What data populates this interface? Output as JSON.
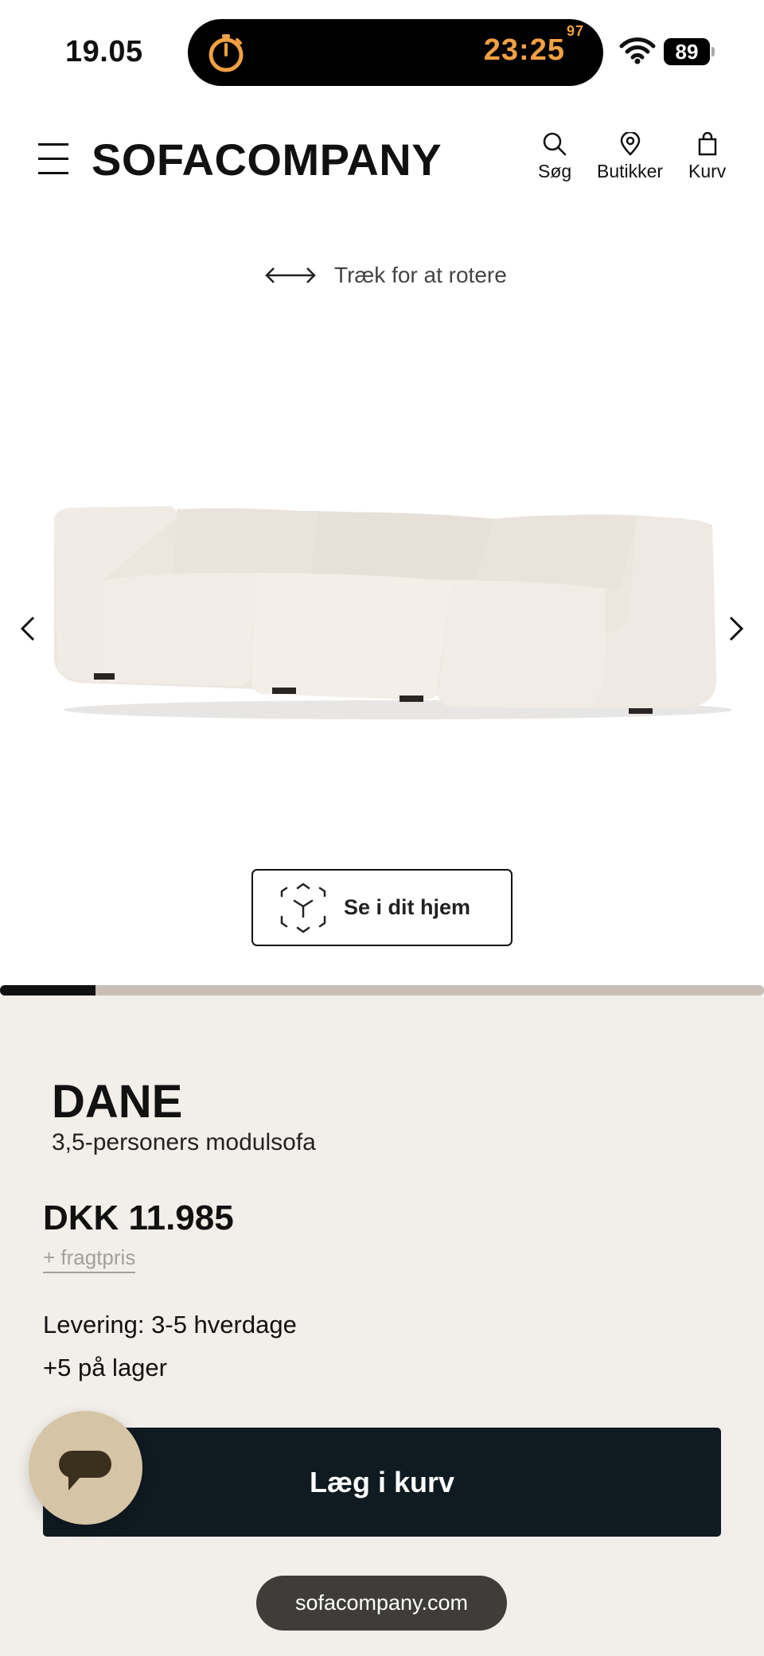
{
  "status_bar": {
    "time": "19.05",
    "timer": "23:25",
    "timer_fraction": "97",
    "battery": "89",
    "timer_color": "#f1a043"
  },
  "header": {
    "logo": "SOFACOMPANY",
    "search_label": "Søg",
    "stores_label": "Butikker",
    "cart_label": "Kurv",
    "icons": [
      "menu-icon",
      "search-icon",
      "location-pin-icon",
      "shopping-bag-icon"
    ]
  },
  "viewer": {
    "rotate_hint": "Træk for at rotere",
    "ar_label": "Se i dit hjem",
    "progress": 0.125
  },
  "product": {
    "name": "DANE",
    "subtitle": "3,5-personers modulsofa",
    "price": "DKK 11.985",
    "freight": "+ fragtpris",
    "delivery": "Levering: 3-5 hverdage",
    "stock": "+5 på lager",
    "add_to_cart": "Læg i kurv"
  },
  "browser": {
    "url": "sofacompany.com"
  },
  "colors": {
    "panel_bg": "#f2efea",
    "cart_button": "#0f1a21",
    "chat_bubble": "#d6c4a6",
    "progress_track": "#c9bfb6"
  }
}
